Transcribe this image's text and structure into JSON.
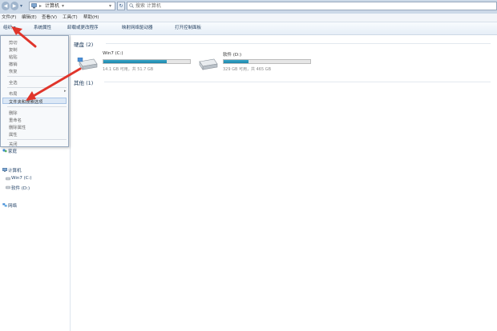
{
  "address": {
    "computer_label": "计算机",
    "search_placeholder": "搜索 计算机"
  },
  "menubar": [
    {
      "label": "文件(F)"
    },
    {
      "label": "编辑(E)"
    },
    {
      "label": "查看(V)"
    },
    {
      "label": "工具(T)"
    },
    {
      "label": "帮助(H)"
    }
  ],
  "commandbar": [
    {
      "label": "组织 ▾"
    },
    {
      "label": "系统属性"
    },
    {
      "label": "卸载或更改程序"
    },
    {
      "label": "映射网络驱动器"
    },
    {
      "label": "打开控制面板"
    }
  ],
  "dropdown": {
    "items": [
      {
        "label": "剪切"
      },
      {
        "label": "复制"
      },
      {
        "label": "粘贴"
      },
      {
        "label": "撤销"
      },
      {
        "label": "恢复"
      },
      {
        "label": "全选"
      },
      {
        "label": "布局"
      },
      {
        "label": "文件夹和搜索选项"
      },
      {
        "label": "删除"
      },
      {
        "label": "重命名"
      },
      {
        "label": "删除属性"
      },
      {
        "label": "属性"
      },
      {
        "label": "关闭"
      }
    ]
  },
  "navpane": {
    "items": [
      {
        "label": "家庭"
      },
      {
        "label": "计算机"
      },
      {
        "label": "Win7 (C:)"
      },
      {
        "label": "软件 (D:)"
      },
      {
        "label": "网络"
      }
    ]
  },
  "content": {
    "hard_disks_title": "硬盘 (2)",
    "other_title": "其他 (1)",
    "drives": [
      {
        "name": "Win7 (C:)",
        "info": "14.1 GB 可用，共 51.7 GB",
        "used_fraction": 0.73
      },
      {
        "name": "软件 (D:)",
        "info": "329 GB 可用，共 465 GB",
        "used_fraction": 0.29
      }
    ]
  },
  "colors": {
    "drive_fill": "#1c86aa",
    "annotation_arrow": "#e0352b"
  }
}
